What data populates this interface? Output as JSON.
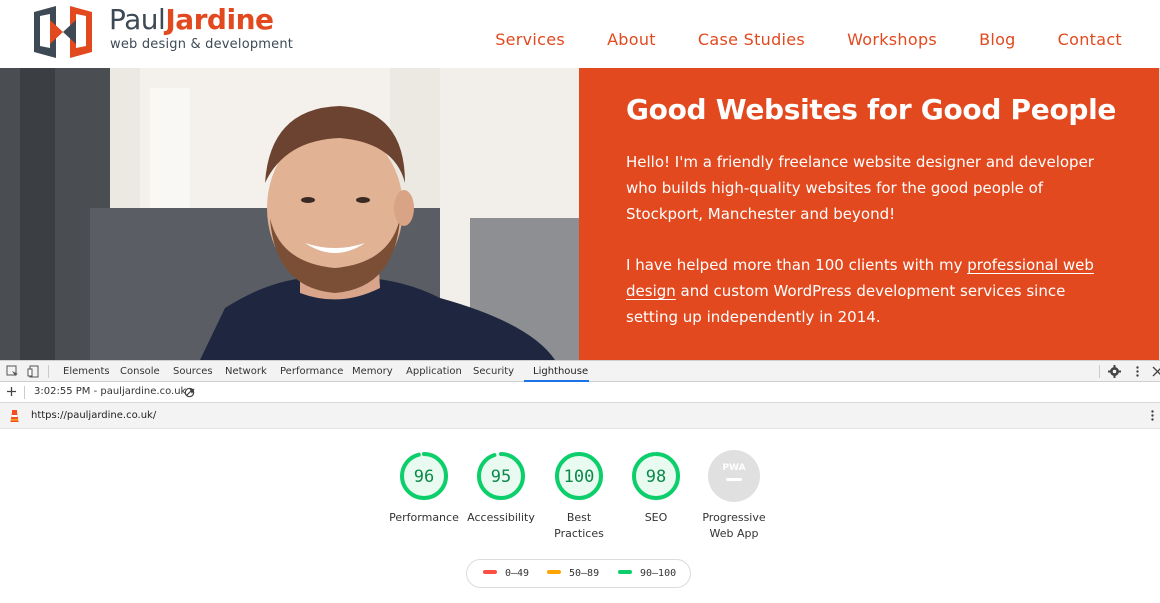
{
  "site": {
    "logo_first": "Paul",
    "logo_last": "Jardine",
    "tagline": "web design & development",
    "nav": [
      "Services",
      "About",
      "Case Studies",
      "Workshops",
      "Blog",
      "Contact"
    ],
    "accent": "#e2491f"
  },
  "hero": {
    "title": "Good Websites for Good People",
    "p1": "Hello! I'm a friendly freelance website designer and developer who builds high-quality websites for the good people of Stockport, Manchester and beyond!",
    "p2_before": "I have helped more than 100 clients with my ",
    "p2_link": "professional web design",
    "p2_after": " and custom WordPress development services since setting up independently in 2014."
  },
  "devtools": {
    "tabs": [
      "Elements",
      "Console",
      "Sources",
      "Network",
      "Performance",
      "Memory",
      "Application",
      "Security",
      "Lighthouse"
    ],
    "active_tab": "Lighthouse",
    "report_selector": "3:02:55 PM - pauljardine.co.uk",
    "url": "https://pauljardine.co.uk/"
  },
  "lighthouse": {
    "gauges": [
      {
        "score": "96",
        "label": "Performance",
        "value": 0.96
      },
      {
        "score": "95",
        "label": "Accessibility",
        "value": 0.95
      },
      {
        "score": "100",
        "label_l1": "Best",
        "label_l2": "Practices",
        "value": 1.0
      },
      {
        "score": "98",
        "label": "SEO",
        "value": 0.98
      }
    ],
    "pwa": {
      "badge": "PWA",
      "label_l1": "Progressive",
      "label_l2": "Web App"
    },
    "legend": [
      {
        "range": "0–49",
        "color": "#ff4e42"
      },
      {
        "range": "50–89",
        "color": "#ffa400"
      },
      {
        "range": "90–100",
        "color": "#0cce6b"
      }
    ],
    "pass_color": "#0cce6b"
  }
}
